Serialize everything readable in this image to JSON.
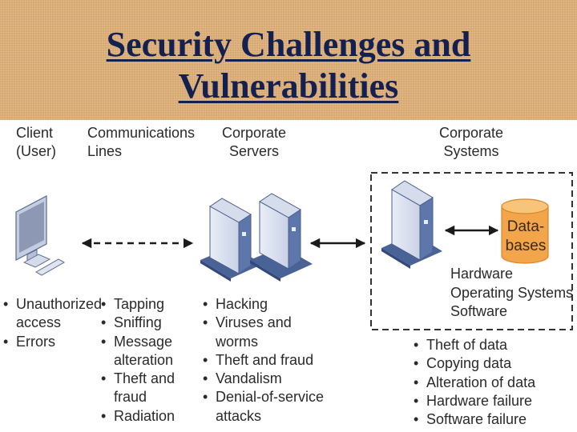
{
  "title": {
    "line1": "Security Challenges and",
    "line2": "Vulnerabilities"
  },
  "columns": [
    {
      "heading": [
        "Client",
        "(User)"
      ],
      "icon": "computer-icon",
      "items": [
        "Unauthorized access",
        "Errors"
      ]
    },
    {
      "heading": [
        "Communications",
        "Lines"
      ],
      "connector": "dashed-double-arrow",
      "items": [
        "Tapping",
        "Sniffing",
        "Message alteration",
        "Theft and fraud",
        "Radiation"
      ]
    },
    {
      "heading": [
        "Corporate",
        "Servers"
      ],
      "icon": "servers-icon",
      "items": [
        "Hacking",
        "Viruses and worms",
        "Theft and fraud",
        "Vandalism",
        "Denial-of-service attacks"
      ]
    },
    {
      "heading": [
        "Corporate",
        "Systems"
      ],
      "icon": "server-icon",
      "database": {
        "label": [
          "Data-",
          "bases"
        ],
        "icon": "database-icon",
        "color": "#f2a54a"
      },
      "components": [
        "Hardware",
        "Operating Systems",
        "Software"
      ],
      "items": [
        "Theft of data",
        "Copying data",
        "Alteration of data",
        "Hardware failure",
        "Software failure"
      ]
    }
  ],
  "colors": {
    "header_bg": "#d8a871",
    "title": "#14204f",
    "server_blue": "#4a6397",
    "database_orange": "#f2a54a"
  }
}
